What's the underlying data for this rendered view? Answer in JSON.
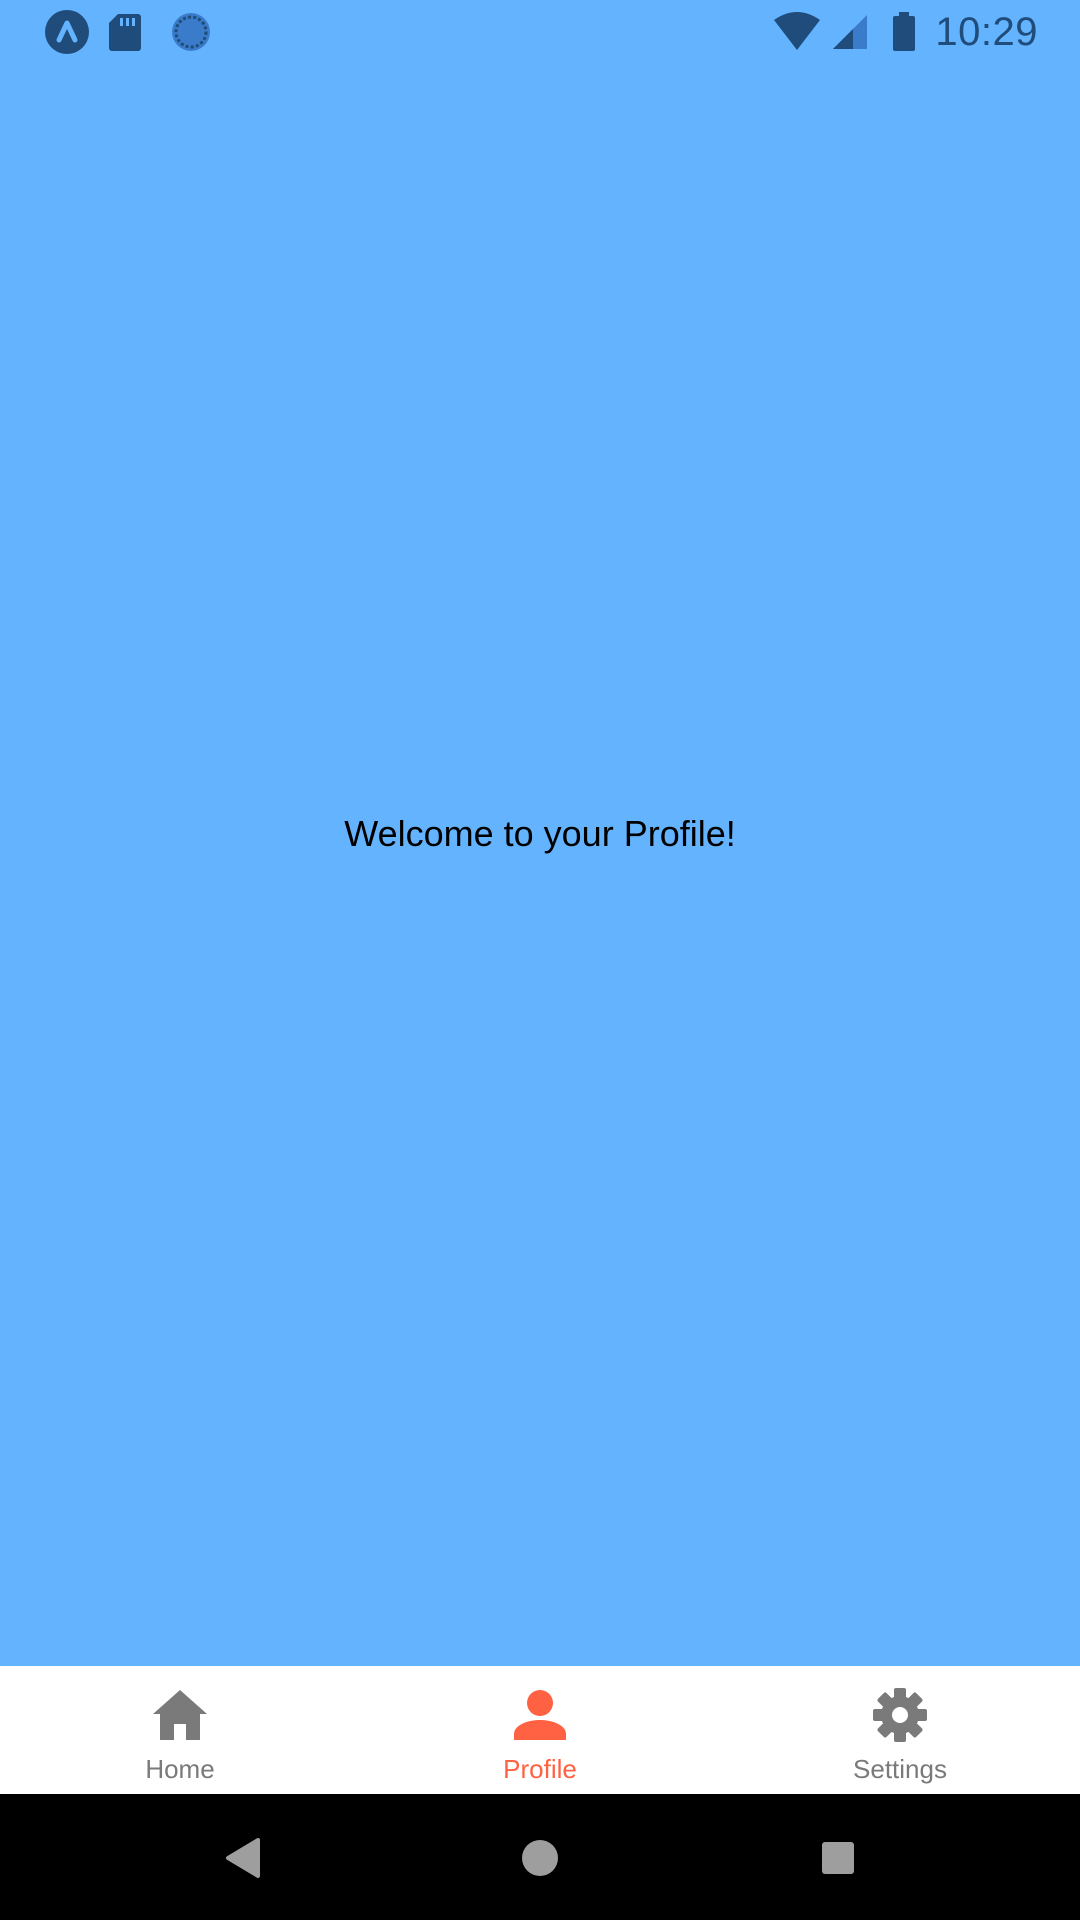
{
  "status_bar": {
    "time": "10:29",
    "left_icons": [
      "app-a-icon",
      "sd-card-icon",
      "sync-icon"
    ],
    "right_icons": [
      "wifi-icon",
      "cell-signal-icon",
      "battery-icon"
    ]
  },
  "main": {
    "welcome_text": "Welcome to your Profile!"
  },
  "tabs": [
    {
      "label": "Home",
      "icon": "home-icon",
      "active": false
    },
    {
      "label": "Profile",
      "icon": "person-icon",
      "active": true
    },
    {
      "label": "Settings",
      "icon": "gear-icon",
      "active": false
    }
  ],
  "nav_bar": {
    "buttons": [
      "back-icon",
      "home-circle-icon",
      "recents-icon"
    ]
  },
  "colors": {
    "background": "#63b3ff",
    "status_icon": "#1f4c7a",
    "tab_active": "#ff6243",
    "tab_inactive": "#7a7a7a",
    "tab_bar_bg": "#ffffff",
    "nav_bar_bg": "#000000",
    "nav_icon": "#9e9e9e"
  }
}
